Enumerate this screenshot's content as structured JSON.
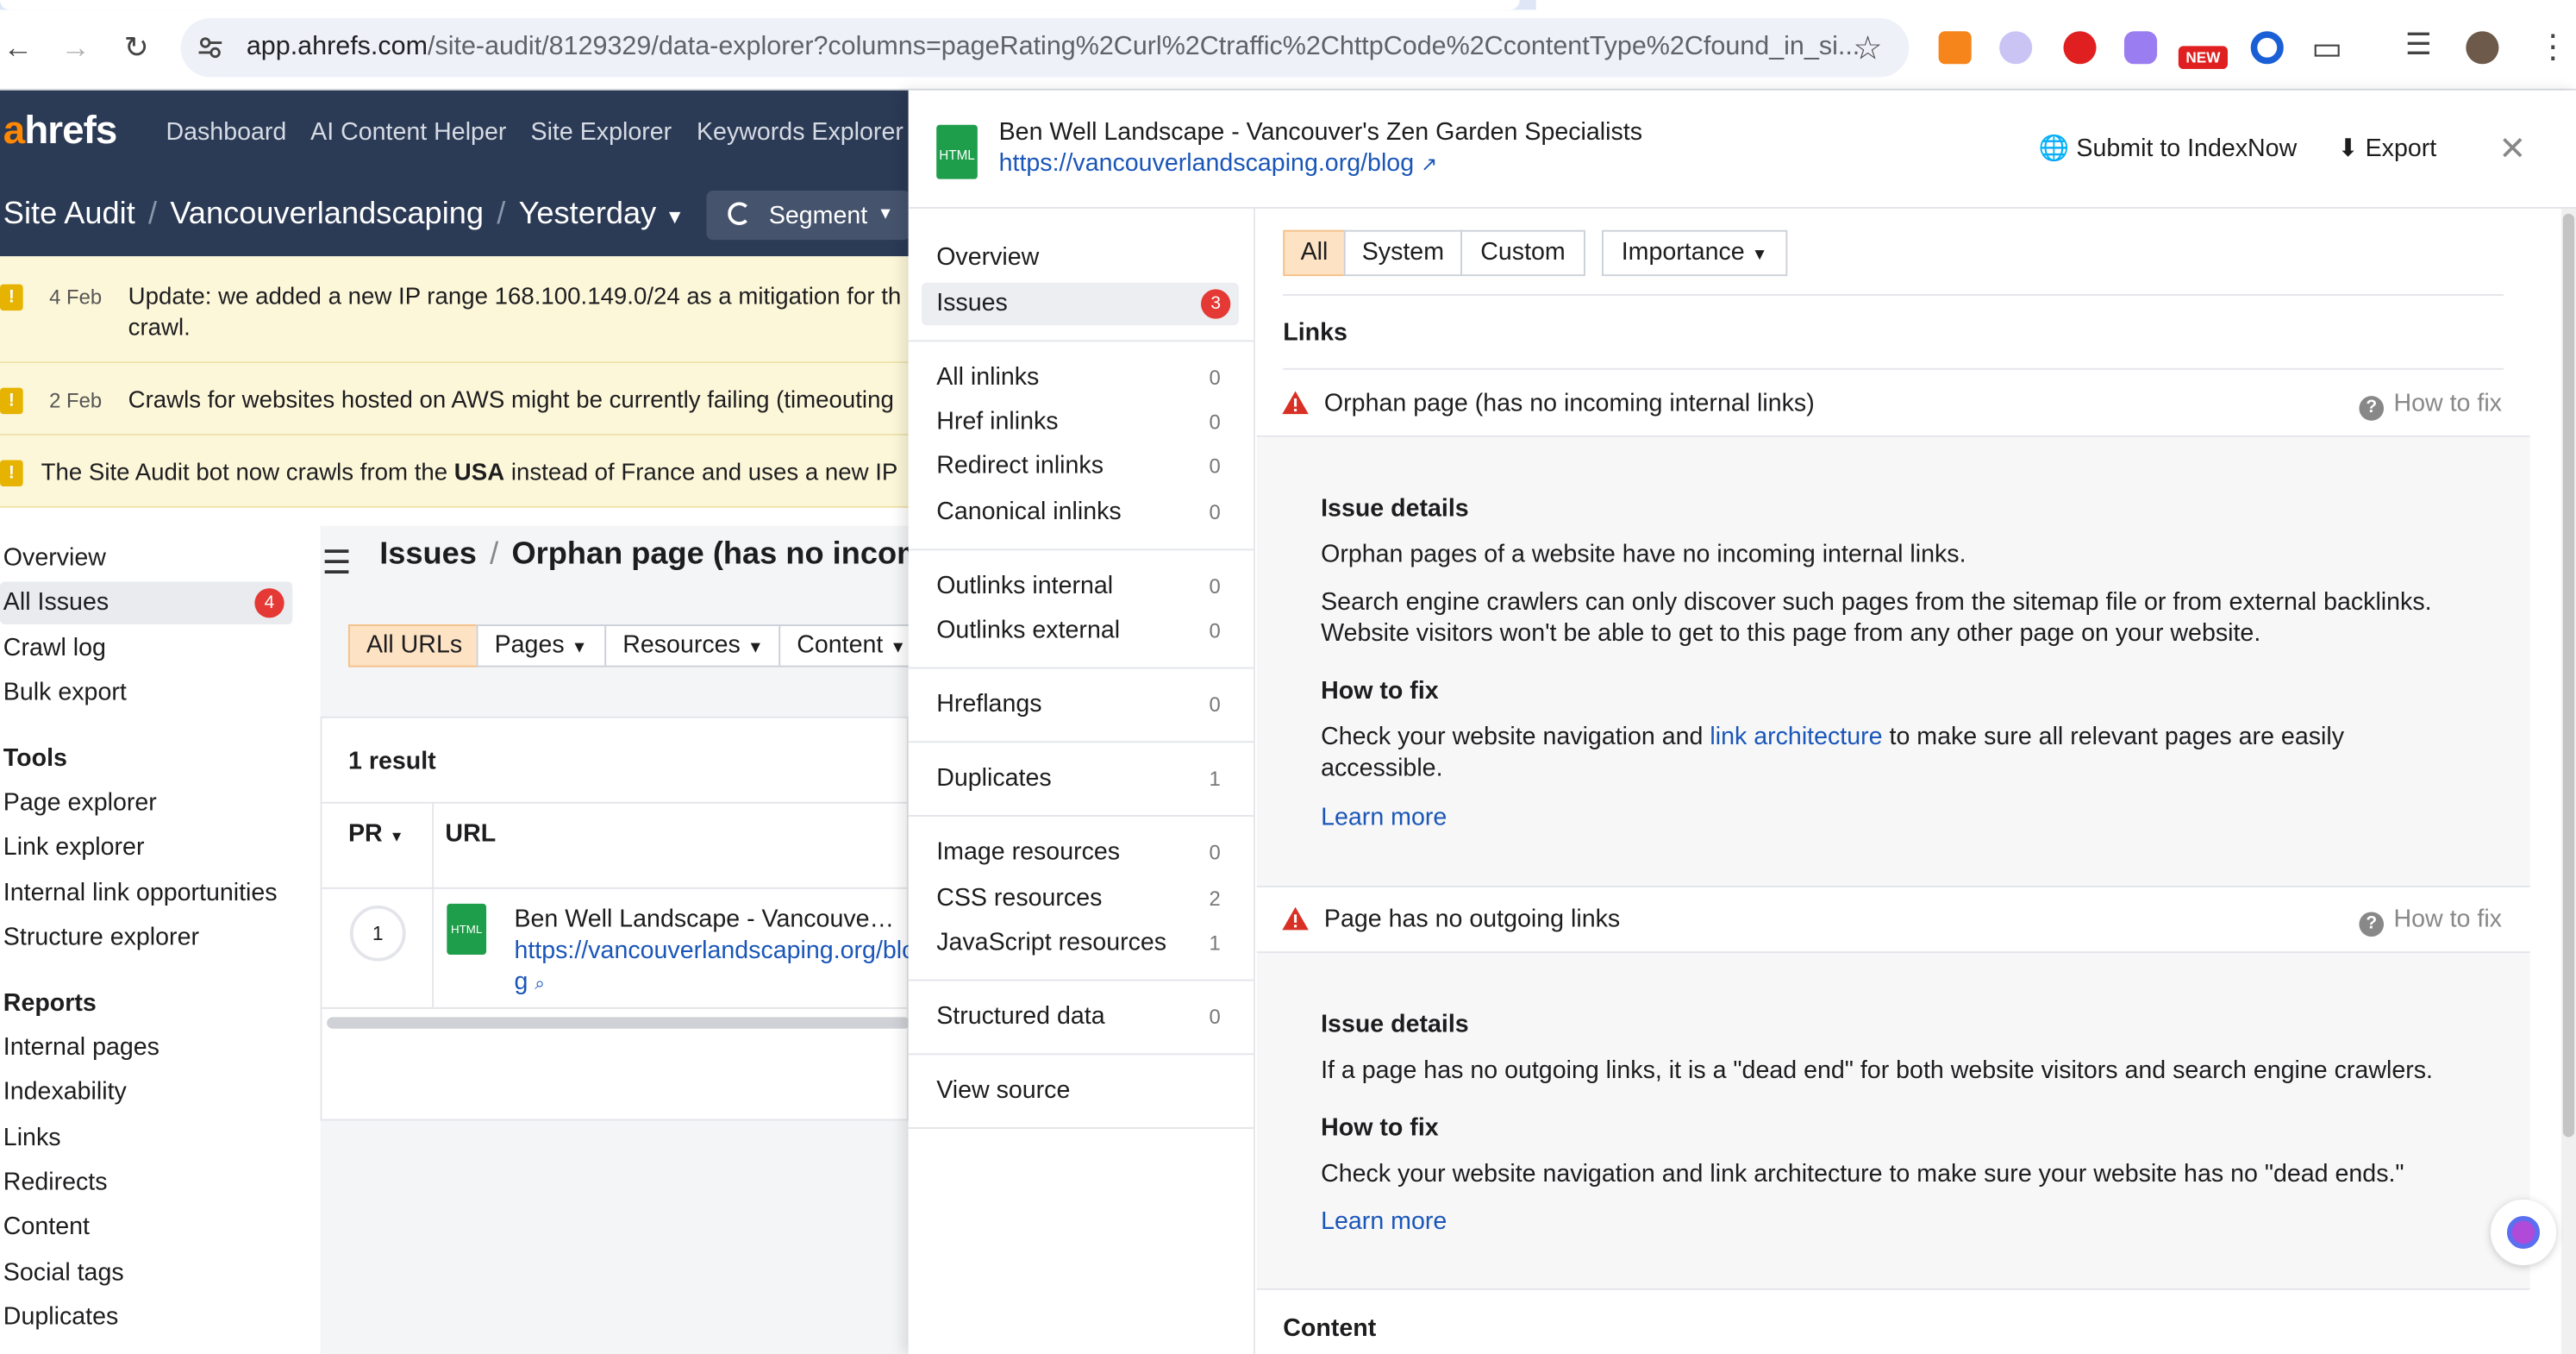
{
  "browser": {
    "url_host": "app.ahrefs.com",
    "url_path": "/site-audit/8129329/data-explorer?columns=pageRating%2Curl%2Ctraffic%2ChttpCode%2CcontentType%2Cfound_in_si..."
  },
  "header": {
    "logo": "ahrefs",
    "nav": [
      "Dashboard",
      "AI Content Helper",
      "Site Explorer",
      "Keywords Explorer"
    ],
    "breadcrumb": [
      "Site Audit",
      "Vancouverlandscaping",
      "Yesterday"
    ],
    "segment_label": "Segment"
  },
  "notices": [
    {
      "date": "4 Feb",
      "text_line1": "Update: we added a new IP range 168.100.149.0/24 as a mitigation for th",
      "text_line2": "crawl."
    },
    {
      "date": "2 Feb",
      "text_line1": "Crawls for websites hosted on AWS might be currently failing (timeouting"
    },
    {
      "text_pre": "The Site Audit bot now crawls from the ",
      "text_bold": "USA",
      "text_post": " instead of France and uses a new IP"
    }
  ],
  "sidebar": {
    "items": [
      "Overview",
      "All Issues",
      "Crawl log",
      "Bulk export"
    ],
    "all_issues_badge": "4",
    "tools_heading": "Tools",
    "tools": [
      "Page explorer",
      "Link explorer",
      "Internal link opportunities",
      "Structure explorer"
    ],
    "reports_heading": "Reports",
    "reports": [
      "Internal pages",
      "Indexability",
      "Links",
      "Redirects",
      "Content",
      "Social tags",
      "Duplicates"
    ]
  },
  "main": {
    "title_root": "Issues",
    "title_sub": "Orphan page (has no incom",
    "filters": [
      "All URLs",
      "Pages",
      "Resources",
      "Content"
    ],
    "result_count": "1 result",
    "col_pr": "PR",
    "col_url": "URL",
    "row": {
      "pr": "1",
      "file_type": "HTML",
      "title": "Ben Well Landscape - Vancouve…",
      "url_line1": "https://vancouverlandscaping.org/blo",
      "url_line2": "g"
    }
  },
  "panel": {
    "file_type": "HTML",
    "page_title": "Ben Well Landscape - Vancouver's Zen Garden Specialists",
    "page_url": "https://vancouverlandscaping.org/blog",
    "submit_label": "Submit to IndexNow",
    "export_label": "Export",
    "nav": {
      "overview": "Overview",
      "issues": "Issues",
      "issues_count": "3",
      "groups": [
        [
          {
            "label": "All inlinks",
            "count": "0"
          },
          {
            "label": "Href inlinks",
            "count": "0"
          },
          {
            "label": "Redirect inlinks",
            "count": "0"
          },
          {
            "label": "Canonical inlinks",
            "count": "0"
          }
        ],
        [
          {
            "label": "Outlinks internal",
            "count": "0"
          },
          {
            "label": "Outlinks external",
            "count": "0"
          }
        ],
        [
          {
            "label": "Hreflangs",
            "count": "0"
          }
        ],
        [
          {
            "label": "Duplicates",
            "count": "1"
          }
        ],
        [
          {
            "label": "Image resources",
            "count": "0"
          },
          {
            "label": "CSS resources",
            "count": "2"
          },
          {
            "label": "JavaScript resources",
            "count": "1"
          }
        ],
        [
          {
            "label": "Structured data",
            "count": "0"
          }
        ],
        [
          {
            "label": "View source"
          }
        ]
      ]
    },
    "tabs": [
      "All",
      "System",
      "Custom"
    ],
    "importance_label": "Importance",
    "section_links": "Links",
    "section_content": "Content",
    "how_to_fix_label": "How to fix",
    "issue1": {
      "title": "Orphan page (has no incoming internal links)",
      "details_heading": "Issue details",
      "details_p1": "Orphan pages of a website have no incoming internal links.",
      "details_p2_l1": "Search engine crawlers can only discover such pages from the sitemap file or from external backlinks.",
      "details_p2_l2": "Website visitors won't be able to get to this page from any other page on your website.",
      "fix_heading": "How to fix",
      "fix_pre": "Check your website navigation and ",
      "fix_link": "link architecture",
      "fix_post": " to make sure all relevant pages are easily",
      "fix_l2": "accessible.",
      "learn_more": "Learn more"
    },
    "issue2": {
      "title": "Page has no outgoing links",
      "details_heading": "Issue details",
      "details_p1": "If a page has no outgoing links, it is a \"dead end\" for both website visitors and search engine crawlers.",
      "fix_heading": "How to fix",
      "fix_text": "Check your website navigation and link architecture to make sure your website has no \"dead ends.\"",
      "learn_more": "Learn more"
    }
  },
  "colors": {
    "accent_orange": "#ff8800",
    "header_navy": "#2b3a55",
    "badge_red": "#e53935",
    "link_blue": "#1a56b8",
    "warning_red": "#d93025"
  }
}
